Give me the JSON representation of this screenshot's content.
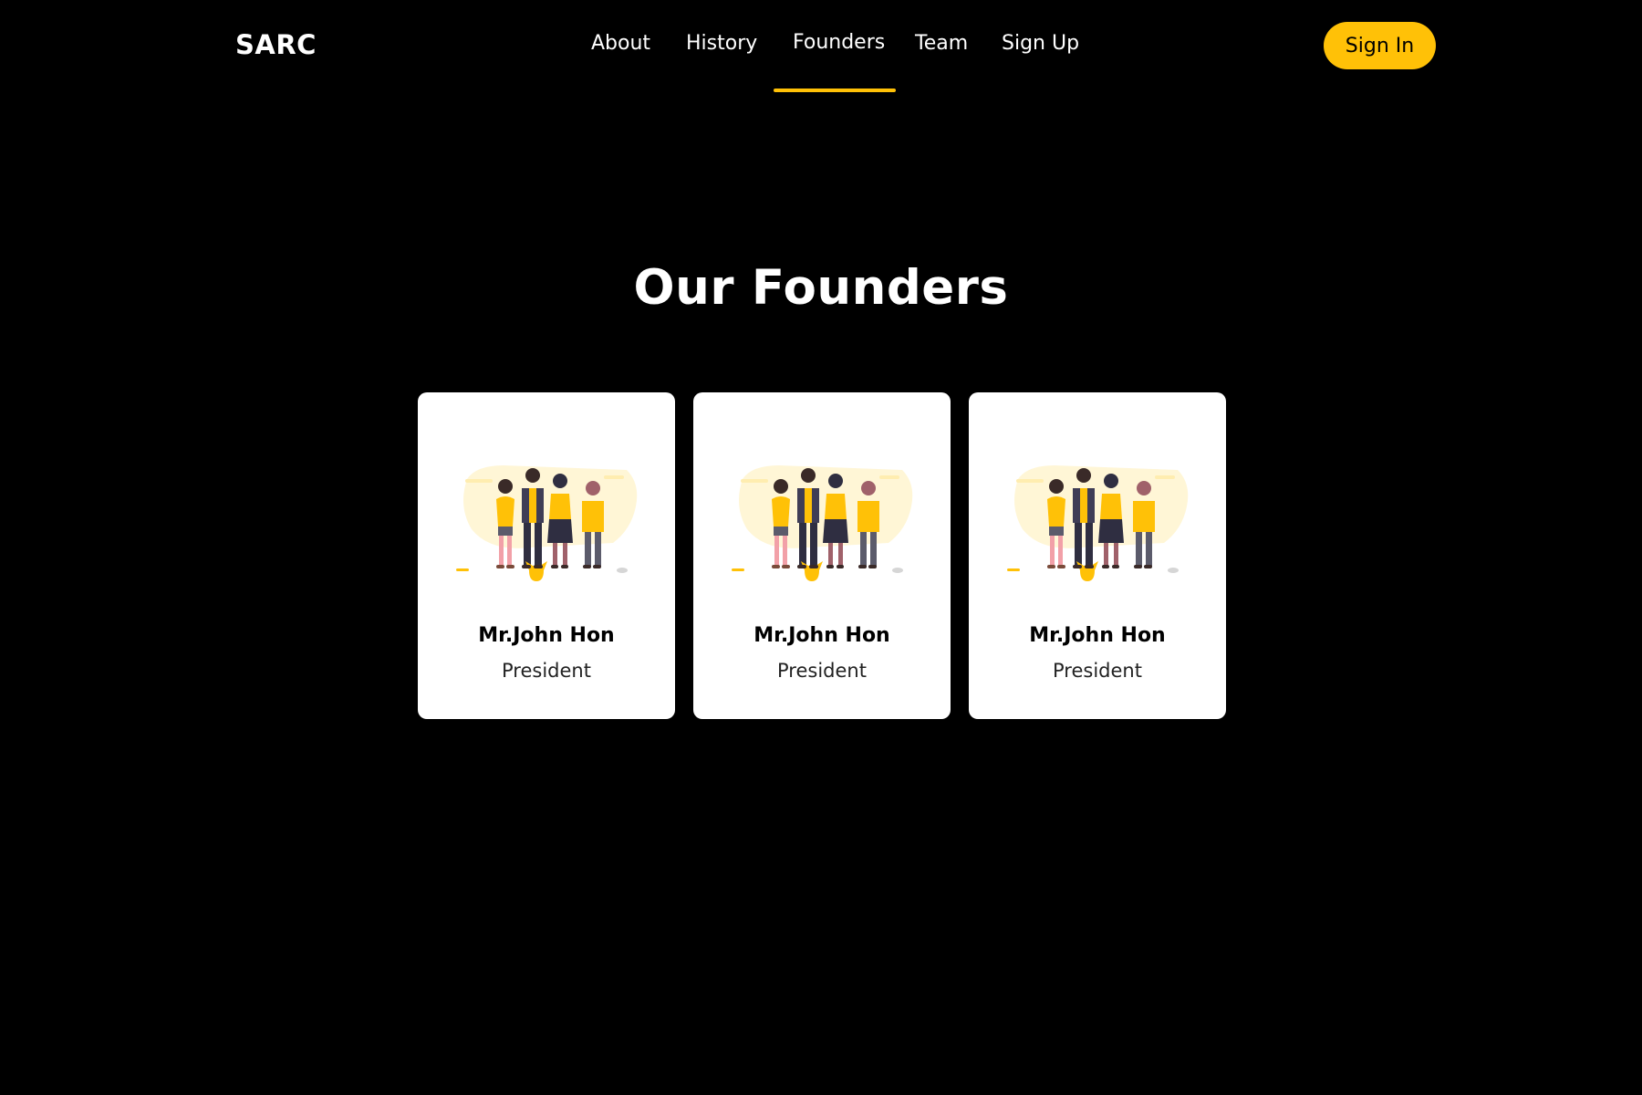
{
  "brand": {
    "logo": "SARC"
  },
  "nav": {
    "items": [
      {
        "label": "About"
      },
      {
        "label": "History"
      },
      {
        "label": "Founders"
      },
      {
        "label": "Team"
      },
      {
        "label": "Sign Up"
      }
    ],
    "active": "Founders",
    "signin_label": "Sign In"
  },
  "section": {
    "title": "Our Founders"
  },
  "founders": [
    {
      "name": "Mr.John Hon",
      "role": "President"
    },
    {
      "name": "Mr.John Hon",
      "role": "President"
    },
    {
      "name": "Mr.John Hon",
      "role": "President"
    }
  ],
  "colors": {
    "background": "#000000",
    "accent": "#FFC107",
    "card": "#FFFFFF"
  },
  "icons": {
    "card_illustration": "team-illustration-icon"
  }
}
